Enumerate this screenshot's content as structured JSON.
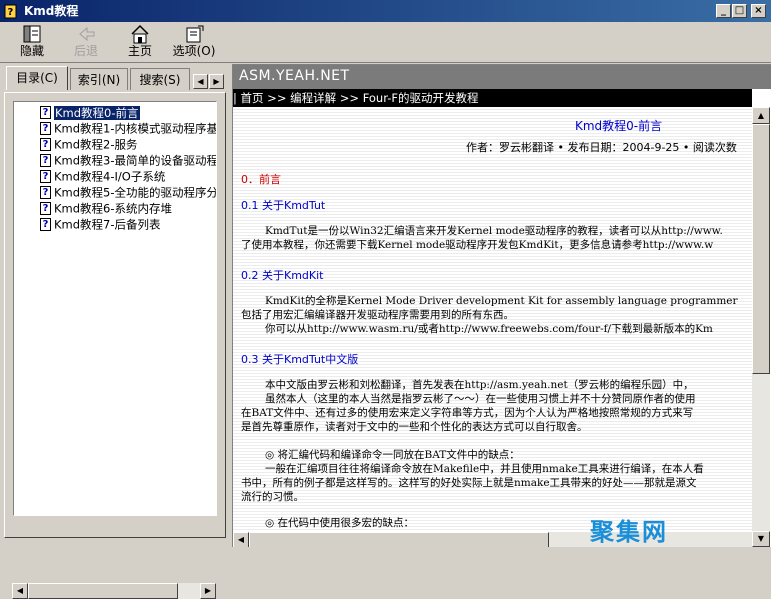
{
  "window": {
    "title": "Kmd教程",
    "buttons": {
      "minimize": "_",
      "maximize": "□",
      "close": "×"
    }
  },
  "toolbar": {
    "hide": "隐藏",
    "back": "后退",
    "home": "主页",
    "options": "选项(O)"
  },
  "nav": {
    "tabs": [
      "目录(C)",
      "索引(N)",
      "搜索(S)"
    ],
    "items": [
      "Kmd教程0-前言",
      "Kmd教程1-内核模式驱动程序基",
      "Kmd教程2-服务",
      "Kmd教程3-最简单的设备驱动程",
      "Kmd教程4-I/O子系统",
      "Kmd教程5-全功能的驱动程序分",
      "Kmd教程6-系统内存堆",
      "Kmd教程7-后备列表"
    ],
    "selected_index": 0,
    "item_icon": "help-page-icon"
  },
  "content": {
    "banner": "ASM.YEAH.NET",
    "breadcrumb": "| 首页 >> 编程详解 >> Four-F的驱动开发教程",
    "title": "Kmd教程0-前言",
    "meta": "作者：罗云彬翻译 • 发布日期：2004-9-25 • 阅读次数",
    "sections": {
      "s0": "0．前言",
      "s01": "0.1 关于KmdTut",
      "s02": "0.2 关于KmdKit",
      "s03": "0.3 关于KmdTut中文版"
    },
    "lines": {
      "l1": "KmdTut是一份以Win32汇编语言来开发Kernel mode驱动程序的教程，读者可以从http://www.",
      "l2": "了使用本教程，你还需要下载Kernel mode驱动程序开发包KmdKit，更多信息请参考http://www.w",
      "l3": "KmdKit的全称是Kernel Mode Driver development Kit for assembly language programmer",
      "l4": "包括了用宏汇编编译器开发驱动程序需要用到的所有东西。",
      "l5": "你可以从http://www.wasm.ru/或者http://www.freewebs.com/four-f/下载到最新版本的Km",
      "l6": "本中文版由罗云彬和刘松翻译，首先发表在http://asm.yeah.net（罗云彬的编程乐园）中，",
      "l7": "虽然本人（这里的本人当然是指罗云彬了～～）在一些使用习惯上并不十分赞同原作者的使用",
      "l8": "在BAT文件中、还有过多的使用宏来定义字符串等方式，因为个人认为严格地按照常规的方式来写",
      "l9": "是首先尊重原作，读者对于文中的一些和个性化的表达方式可以自行取舍。",
      "l10": "◎ 将汇编代码和编译命令一同放在BAT文件中的缺点：",
      "l11": "一般在汇编项目往往将编译命令放在Makefile中，并且使用nmake工具来进行编译，在本人看",
      "l12": "书中，所有的例子都是这样写的。这样写的好处实际上就是nmake工具带来的好处——那就是源文",
      "l13": "流行的习惯。",
      "l14": "◎ 在代码中使用很多宏的缺点："
    }
  },
  "watermark": "聚集网",
  "colors": {
    "titlebar": "#0a246a",
    "banner": "#7b7b7b",
    "section_blue": "#0000cc",
    "preface_red": "#cc0000"
  }
}
